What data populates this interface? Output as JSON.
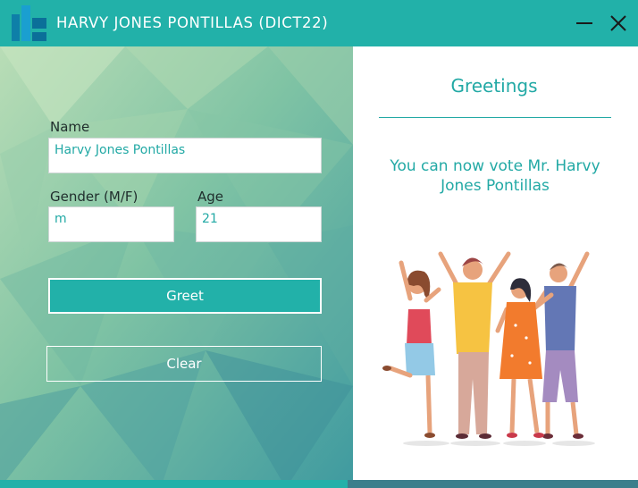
{
  "window": {
    "title": "HARVY JONES PONTILLAS (DICT22)",
    "accent_color": "#22b1a9",
    "icons": {
      "logo": "app-logo",
      "minimize": "minimize-icon",
      "close": "close-icon"
    }
  },
  "form": {
    "name_label": "Name",
    "name_value": "Harvy Jones Pontillas",
    "gender_label": "Gender (M/F)",
    "gender_value": "m",
    "age_label": "Age",
    "age_value": "21",
    "greet_button": "Greet",
    "clear_button": "Clear"
  },
  "greeting": {
    "title": "Greetings",
    "message": "You can now vote Mr. Harvy Jones Pontillas",
    "text_color": "#22a9a5"
  }
}
